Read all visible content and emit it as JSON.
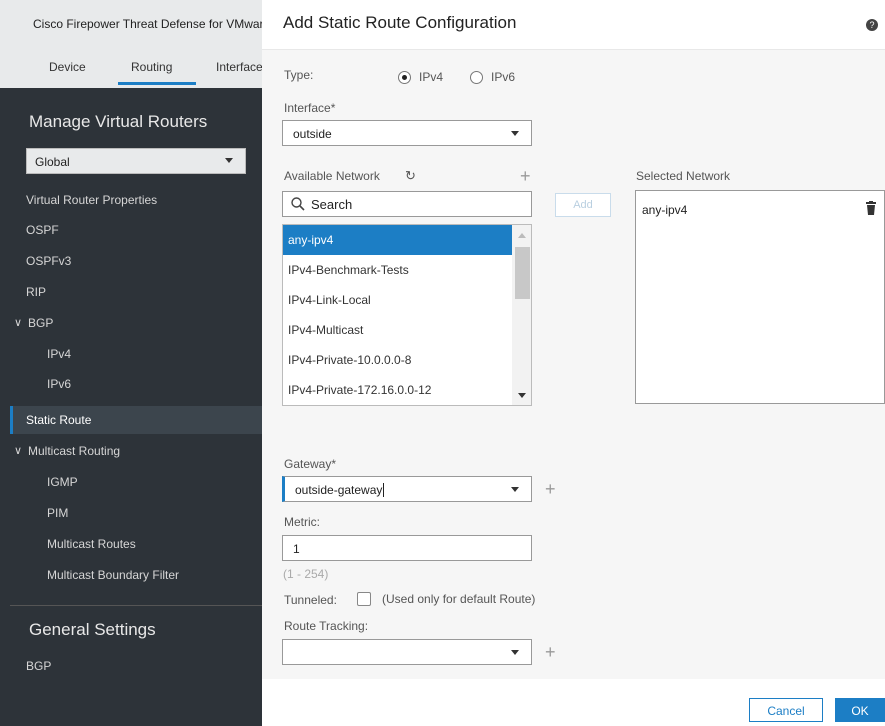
{
  "app": {
    "title": "Cisco Firepower Threat Defense for VMware"
  },
  "tabs": [
    {
      "label": "Device"
    },
    {
      "label": "Routing"
    },
    {
      "label": "Interfaces"
    }
  ],
  "sidebar": {
    "manage_heading": "Manage Virtual Routers",
    "router_select": "Global",
    "items": [
      {
        "label": "Virtual Router Properties"
      },
      {
        "label": "OSPF"
      },
      {
        "label": "OSPFv3"
      },
      {
        "label": "RIP"
      },
      {
        "label": "BGP"
      },
      {
        "label": "IPv4"
      },
      {
        "label": "IPv6"
      },
      {
        "label": "Static Route"
      },
      {
        "label": "Multicast Routing"
      },
      {
        "label": "IGMP"
      },
      {
        "label": "PIM"
      },
      {
        "label": "Multicast Routes"
      },
      {
        "label": "Multicast Boundary Filter"
      }
    ],
    "general_heading": "General Settings",
    "general_items": [
      {
        "label": "BGP"
      }
    ]
  },
  "dialog": {
    "title": "Add Static Route Configuration",
    "type_label": "Type:",
    "type_options": [
      "IPv4",
      "IPv6"
    ],
    "type_selected": "IPv4",
    "interface_label": "Interface*",
    "interface_value": "outside",
    "available_label": "Available Network",
    "search_placeholder": "Search",
    "networks": [
      "any-ipv4",
      "IPv4-Benchmark-Tests",
      "IPv4-Link-Local",
      "IPv4-Multicast",
      "IPv4-Private-10.0.0.0-8",
      "IPv4-Private-172.16.0.0-12"
    ],
    "add_button": "Add",
    "selected_label": "Selected Network",
    "selected_networks": [
      "any-ipv4"
    ],
    "gateway_label": "Gateway*",
    "gateway_value": "outside-gateway",
    "metric_label": "Metric:",
    "metric_value": "1",
    "metric_hint": "(1 - 254)",
    "tunneled_label": "Tunneled:",
    "tunneled_note": "(Used only for default Route)",
    "tracking_label": "Route Tracking:",
    "tracking_value": "",
    "cancel_button": "Cancel",
    "ok_button": "OK"
  },
  "colors": {
    "accent": "#1c7ec5",
    "sidebar_bg": "#2d3339"
  }
}
